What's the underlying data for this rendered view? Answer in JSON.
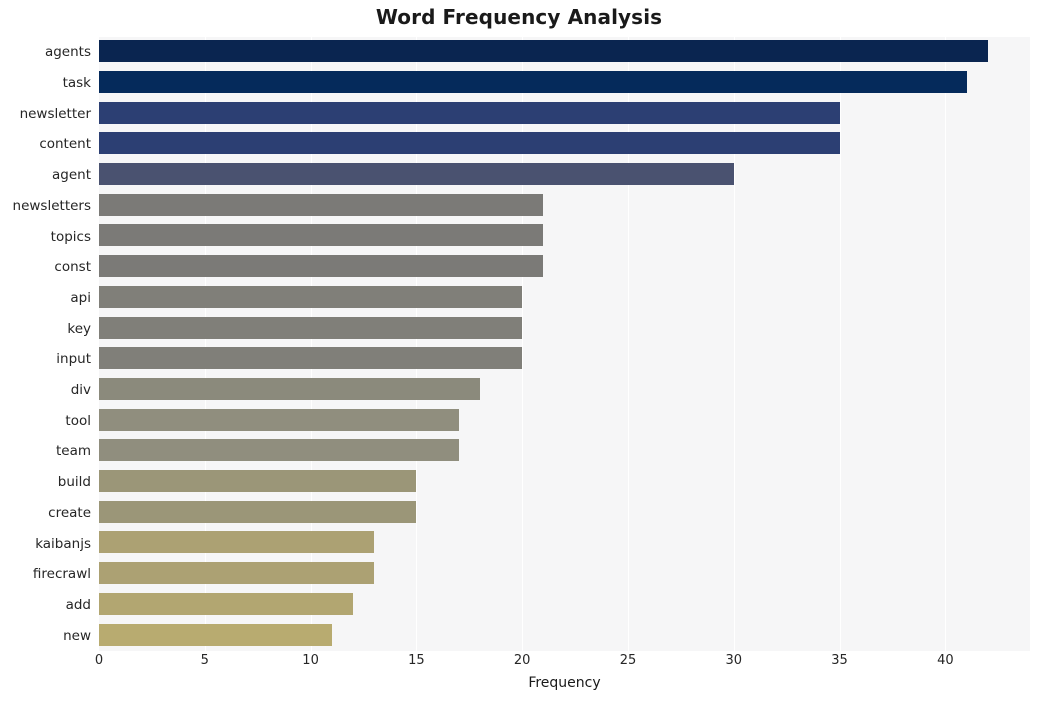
{
  "chart_data": {
    "type": "bar",
    "orientation": "horizontal",
    "title": "Word Frequency Analysis",
    "xlabel": "Frequency",
    "ylabel": "",
    "categories": [
      "agents",
      "task",
      "newsletter",
      "content",
      "agent",
      "newsletters",
      "topics",
      "const",
      "api",
      "key",
      "input",
      "div",
      "tool",
      "team",
      "build",
      "create",
      "kaibanjs",
      "firecrawl",
      "add",
      "new"
    ],
    "values": [
      42,
      41,
      35,
      35,
      30,
      21,
      21,
      21,
      20,
      20,
      20,
      18,
      17,
      17,
      15,
      15,
      13,
      13,
      12,
      11
    ],
    "xlim": [
      0,
      44
    ],
    "xticks": [
      0,
      5,
      10,
      15,
      20,
      25,
      30,
      35,
      40
    ],
    "xtick_labels": [
      "0",
      "5",
      "10",
      "15",
      "20",
      "25",
      "30",
      "35",
      "40"
    ],
    "grid": true,
    "grid_axis": "x",
    "grid_color": "#ffffff",
    "plot_background": "#f6f6f7",
    "figure_background": "#ffffff",
    "legend": null,
    "bar_colors": [
      "#0a2550",
      "#052a5b",
      "#2c3f73",
      "#2c3f73",
      "#4a5270",
      "#7b7a77",
      "#7b7a77",
      "#7b7a77",
      "#807f79",
      "#807f79",
      "#807f79",
      "#8b8a7c",
      "#908e7e",
      "#908e7e",
      "#9b9678",
      "#9b9678",
      "#aca173",
      "#aca173",
      "#b2a671",
      "#b8ab70"
    ]
  }
}
